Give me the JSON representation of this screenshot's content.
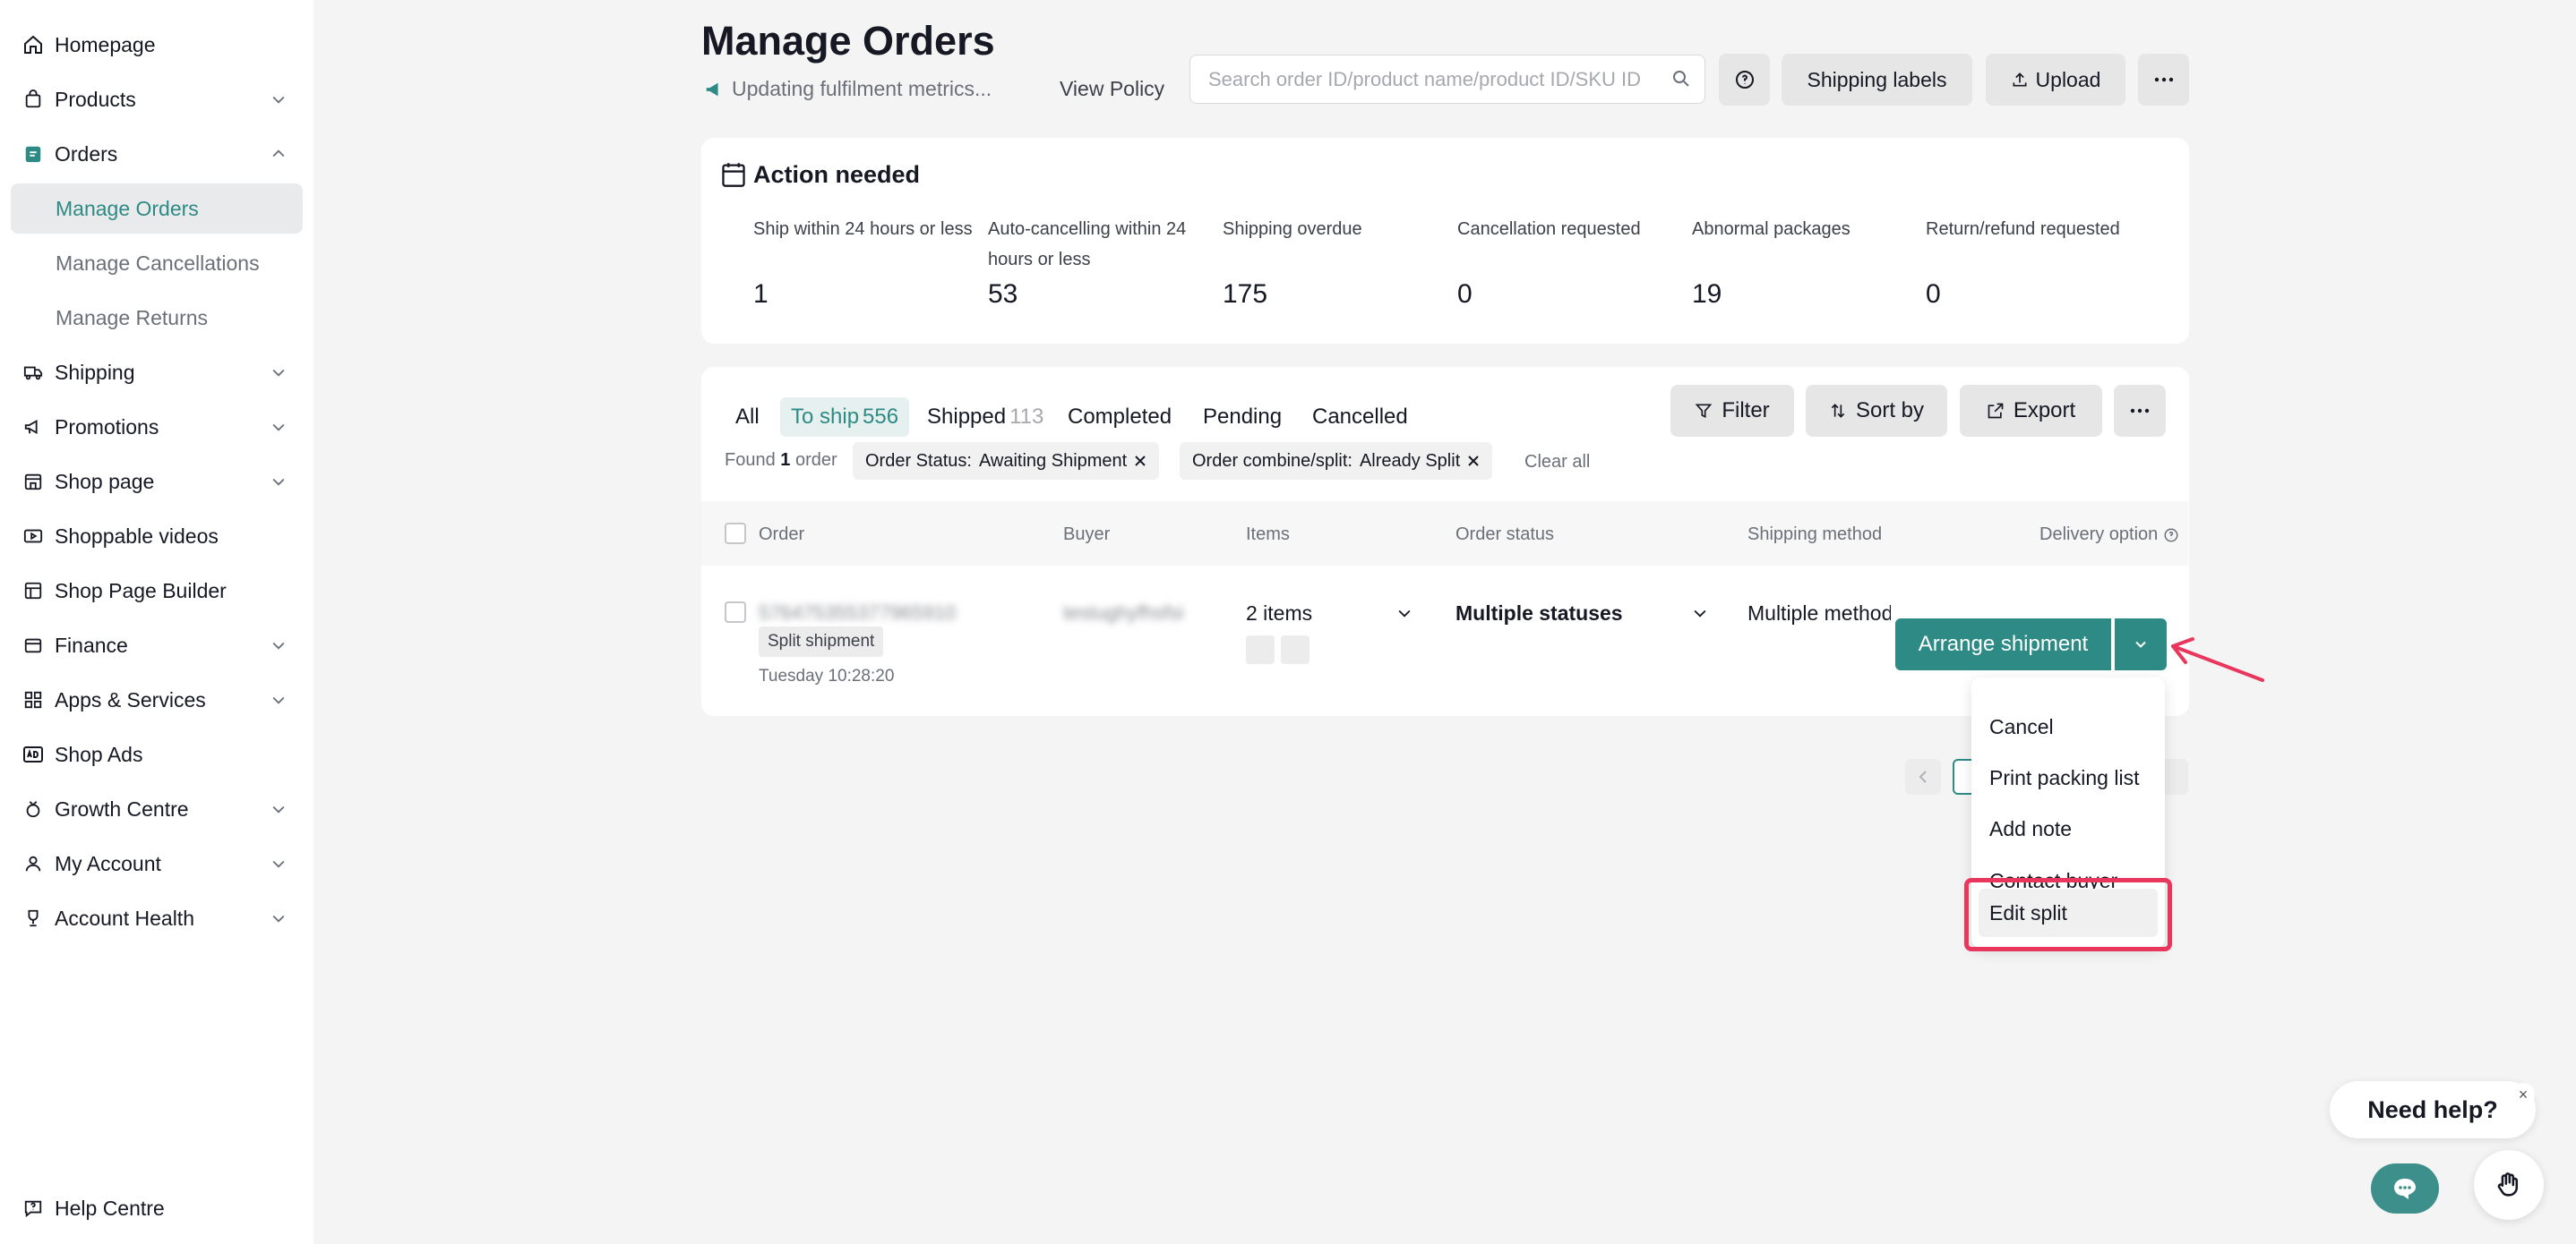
{
  "sidebar": {
    "items": [
      {
        "label": "Homepage",
        "icon": "home-icon"
      },
      {
        "label": "Products",
        "icon": "bag-icon"
      },
      {
        "label": "Orders",
        "icon": "clipboard-icon"
      },
      {
        "label": "Shipping",
        "icon": "truck-icon"
      },
      {
        "label": "Promotions",
        "icon": "megaphone-icon"
      },
      {
        "label": "Shop page",
        "icon": "store-icon"
      },
      {
        "label": "Shoppable videos",
        "icon": "video-icon"
      },
      {
        "label": "Shop Page Builder",
        "icon": "builder-icon"
      },
      {
        "label": "Finance",
        "icon": "wallet-icon"
      },
      {
        "label": "Apps & Services",
        "icon": "apps-icon"
      },
      {
        "label": "Shop Ads",
        "icon": "ads-icon"
      },
      {
        "label": "Growth Centre",
        "icon": "medal-icon"
      },
      {
        "label": "My Account",
        "icon": "user-icon"
      },
      {
        "label": "Account Health",
        "icon": "trophy-icon"
      }
    ],
    "orders_sub": [
      "Manage Orders",
      "Manage Cancellations",
      "Manage Returns"
    ],
    "help": "Help Centre"
  },
  "header": {
    "title": "Manage Orders",
    "notice": "Updating fulfilment metrics...",
    "view_policy": "View Policy",
    "search_placeholder": "Search order ID/product name/product ID/SKU ID",
    "shipping_labels": "Shipping labels",
    "upload": "Upload"
  },
  "action_needed": {
    "title": "Action needed",
    "metrics": [
      {
        "label": "Ship within 24 hours or less",
        "value": "1"
      },
      {
        "label": "Auto-cancelling within 24 hours or less",
        "value": "53"
      },
      {
        "label": "Shipping overdue",
        "value": "175"
      },
      {
        "label": "Cancellation requested",
        "value": "0"
      },
      {
        "label": "Abnormal packages",
        "value": "19"
      },
      {
        "label": "Return/refund requested",
        "value": "0"
      }
    ]
  },
  "tabs": [
    {
      "label": "All",
      "count": ""
    },
    {
      "label": "To ship",
      "count": "556"
    },
    {
      "label": "Shipped",
      "count": "113"
    },
    {
      "label": "Completed",
      "count": ""
    },
    {
      "label": "Pending",
      "count": ""
    },
    {
      "label": "Cancelled",
      "count": ""
    }
  ],
  "toolbar": {
    "filter": "Filter",
    "sort_by": "Sort by",
    "export": "Export"
  },
  "filters": {
    "found_prefix": "Found",
    "found_count": "1",
    "found_suffix": "order",
    "chips": [
      {
        "key": "Order Status:",
        "value": "Awaiting Shipment"
      },
      {
        "key": "Order combine/split:",
        "value": "Already Split"
      }
    ],
    "clear_all": "Clear all"
  },
  "table": {
    "columns": [
      "Order",
      "Buyer",
      "Items",
      "Order status",
      "Shipping method",
      "Delivery option"
    ],
    "row": {
      "order_id": "576475355377965910",
      "buyer": "testughyfhsfsi",
      "badge": "Split shipment",
      "time": "Tuesday 10:28:20",
      "items": "2 items",
      "status": "Multiple statuses",
      "shipping": "Multiple methods",
      "action": "Arrange shipment"
    }
  },
  "menu": [
    "Cancel",
    "Print packing list",
    "Add note",
    "Contact buyer",
    "Edit split"
  ],
  "help_widget": {
    "text": "Need help?"
  },
  "colors": {
    "accent": "#2e8a85",
    "highlight": "#e8365d"
  }
}
